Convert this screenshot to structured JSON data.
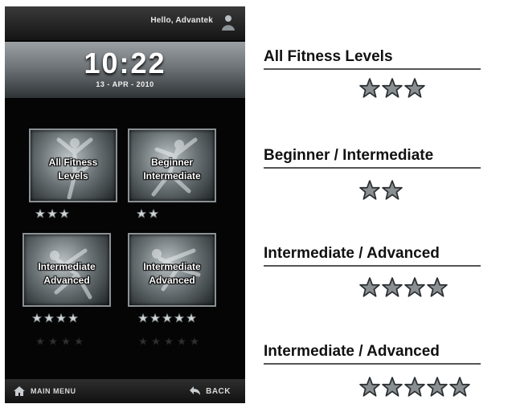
{
  "device": {
    "greeting": "Hello, Advantek",
    "time": "10:22",
    "date": "13 - APR - 2010",
    "tiles": [
      {
        "label": "All Fitness\nLevels",
        "stars": 3
      },
      {
        "label": "Beginner\nIntermediate",
        "stars": 2
      },
      {
        "label": "Intermediate\nAdvanced",
        "stars": 4
      },
      {
        "label": "Intermediate\nAdvanced",
        "stars": 5
      }
    ],
    "main_menu_label": "MAIN MENU",
    "back_label": "BACK"
  },
  "levels": [
    {
      "title": "All Fitness Levels",
      "stars": 3
    },
    {
      "title": "Beginner / Intermediate",
      "stars": 2
    },
    {
      "title": "Intermediate / Advanced",
      "stars": 4
    },
    {
      "title": "Intermediate / Advanced",
      "stars": 5
    }
  ],
  "colors": {
    "device_bg": "#050505",
    "star_fill": "#8a8f92",
    "star_stroke": "#2b2f31"
  },
  "icons": {
    "user": "user-icon",
    "home": "home-icon",
    "back": "back-arrow-icon",
    "star": "star-icon"
  }
}
